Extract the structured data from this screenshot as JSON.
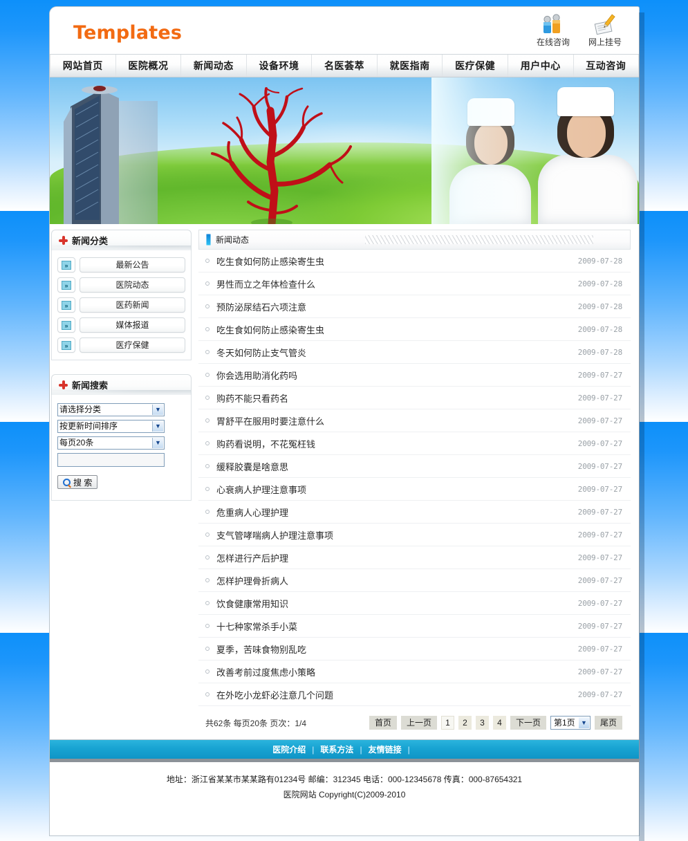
{
  "header": {
    "logo": "Templates",
    "toplinks": [
      {
        "label": "在线咨询",
        "icon": "people-icon"
      },
      {
        "label": "网上挂号",
        "icon": "pen-icon"
      }
    ]
  },
  "nav": {
    "items": [
      "网站首页",
      "医院概况",
      "新闻动态",
      "设备环境",
      "名医荟萃",
      "就医指南",
      "医疗保健",
      "用户中心",
      "互动咨询"
    ]
  },
  "sidebar": {
    "category_panel": {
      "title": "新闻分类",
      "items": [
        "最新公告",
        "医院动态",
        "医药新闻",
        "媒体报道",
        "医疗保健"
      ]
    },
    "search_panel": {
      "title": "新闻搜索",
      "category_select": "请选择分类",
      "sort_select": "按更新时间排序",
      "perpage_select": "每页20条",
      "keyword_value": "",
      "keyword_placeholder": "",
      "search_button": "搜 索"
    }
  },
  "main": {
    "header_title": "新闻动态",
    "news": [
      {
        "title": "吃生食如何防止感染寄生虫",
        "date": "2009-07-28"
      },
      {
        "title": "男性而立之年体检查什么",
        "date": "2009-07-28"
      },
      {
        "title": "预防泌尿结石六项注意",
        "date": "2009-07-28"
      },
      {
        "title": "吃生食如何防止感染寄生虫",
        "date": "2009-07-28"
      },
      {
        "title": "冬天如何防止支气管炎",
        "date": "2009-07-28"
      },
      {
        "title": "你会选用助消化药吗",
        "date": "2009-07-27"
      },
      {
        "title": "购药不能只看药名",
        "date": "2009-07-27"
      },
      {
        "title": "胃舒平在服用时要注意什么",
        "date": "2009-07-27"
      },
      {
        "title": "购药看说明，不花冤枉钱",
        "date": "2009-07-27"
      },
      {
        "title": "缓释胶囊是啥意思",
        "date": "2009-07-27"
      },
      {
        "title": "心衰病人护理注意事项",
        "date": "2009-07-27"
      },
      {
        "title": "危重病人心理护理",
        "date": "2009-07-27"
      },
      {
        "title": "支气管哮喘病人护理注意事项",
        "date": "2009-07-27"
      },
      {
        "title": "怎样进行产后护理",
        "date": "2009-07-27"
      },
      {
        "title": "怎样护理骨折病人",
        "date": "2009-07-27"
      },
      {
        "title": "饮食健康常用知识",
        "date": "2009-07-27"
      },
      {
        "title": "十七种家常杀手小菜",
        "date": "2009-07-27"
      },
      {
        "title": "夏季，苦味食物别乱吃",
        "date": "2009-07-27"
      },
      {
        "title": "改善考前过度焦虑小策略",
        "date": "2009-07-27"
      },
      {
        "title": "在外吃小龙虾必注意几个问题",
        "date": "2009-07-27"
      }
    ],
    "pager": {
      "info": "共62条 每页20条 页次：1/4",
      "first": "首页",
      "prev": "上一页",
      "pages": [
        "1",
        "2",
        "3",
        "4"
      ],
      "next": "下一页",
      "jump_value": "第1页",
      "last": "尾页"
    }
  },
  "footer": {
    "links": [
      "医院介绍",
      "联系方法",
      "友情链接"
    ],
    "separator": "|",
    "address": "地址：浙江省某某市某某路有01234号 邮编：312345 电话：000-12345678 传真：000-87654321",
    "copyright": "医院网站 Copyright(C)2009-2010"
  },
  "colors": {
    "logo_orange": "#f26a12",
    "footer_blue": "#18a3d2",
    "accent_blue": "#0d7fd6",
    "cross_red": "#d8342b",
    "page_bg_blue": "#2fa0fb"
  }
}
